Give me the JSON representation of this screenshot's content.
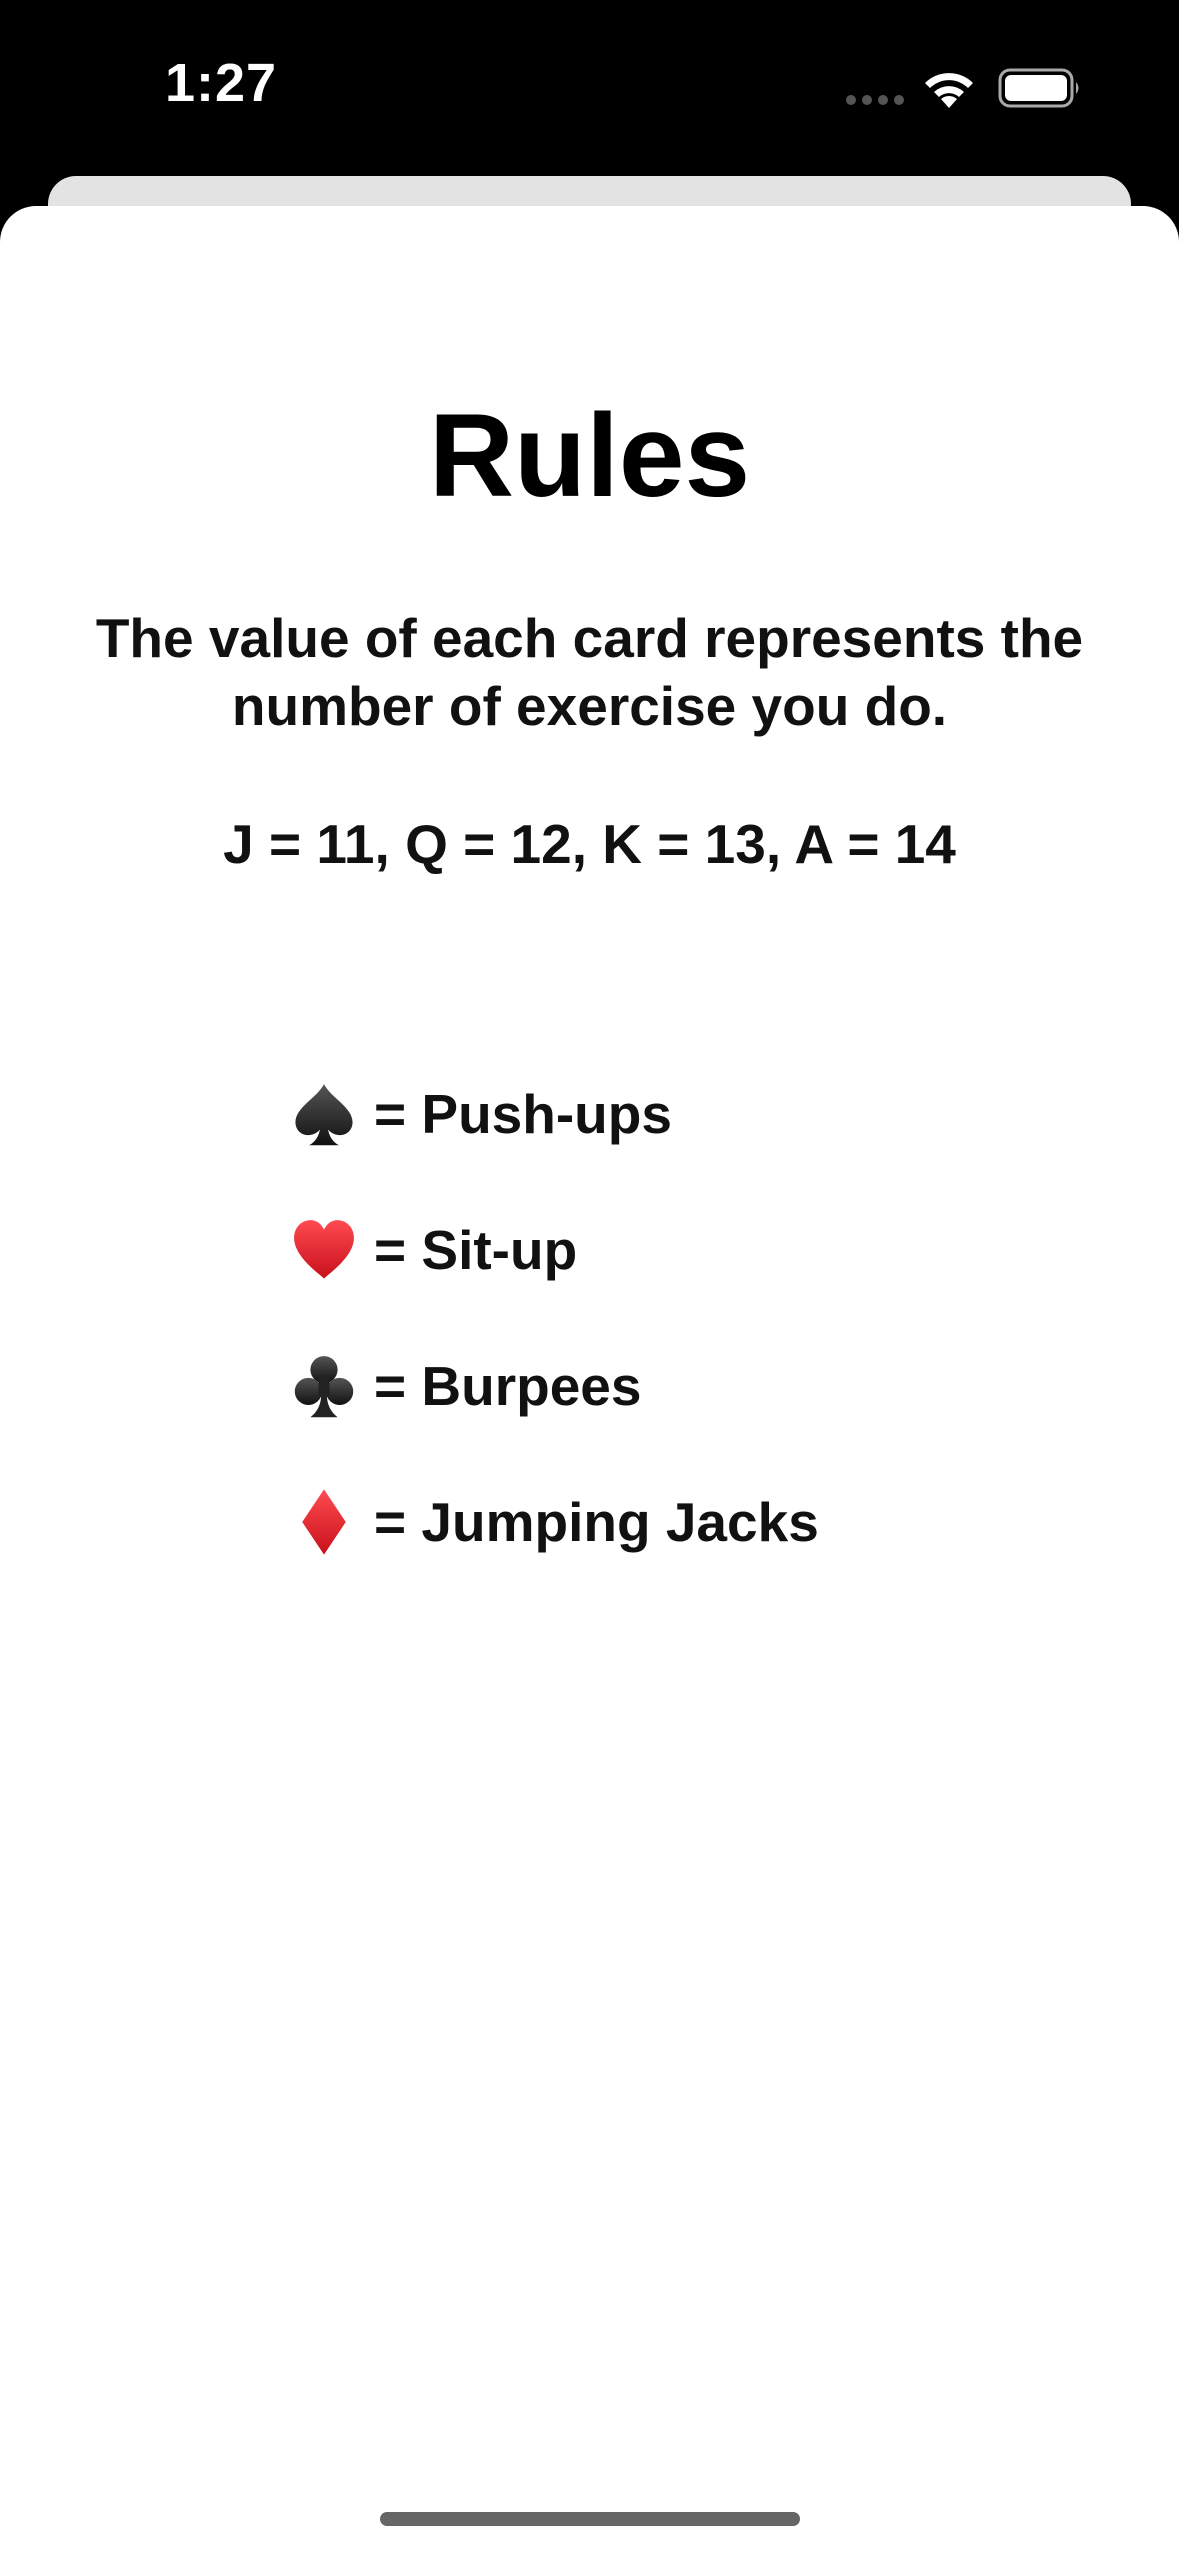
{
  "status_bar": {
    "time": "1:27"
  },
  "rules": {
    "title": "Rules",
    "description": "The value of each card represents the number of exercise you do.",
    "card_values": "J = 11, Q = 12, K = 13, A = 14",
    "suits": [
      {
        "icon": "spade-icon",
        "label": "= Push-ups",
        "color": "#1a1a1a"
      },
      {
        "icon": "heart-icon",
        "label": "= Sit-up",
        "color": "#e0161f"
      },
      {
        "icon": "club-icon",
        "label": "= Burpees",
        "color": "#1a1a1a"
      },
      {
        "icon": "diamond-icon",
        "label": "= Jumping Jacks",
        "color": "#e0161f"
      }
    ]
  }
}
